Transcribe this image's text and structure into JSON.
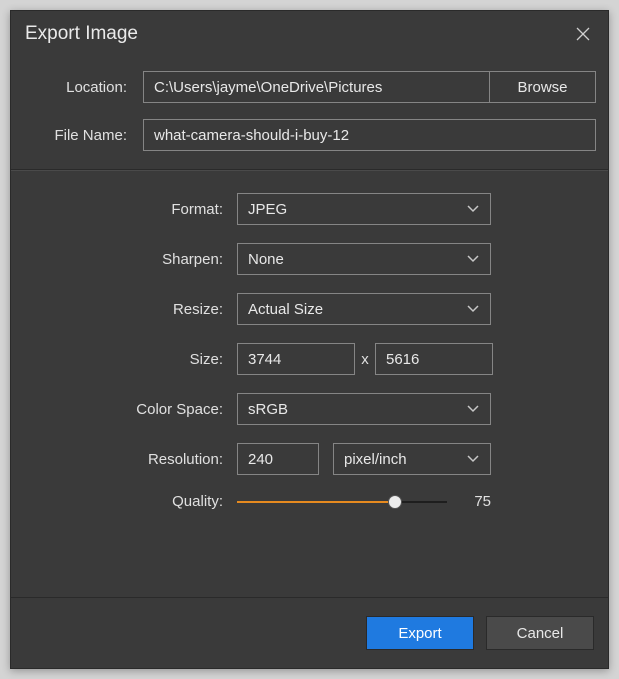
{
  "title": "Export Image",
  "location": {
    "label": "Location:",
    "value": "C:\\Users\\jayme\\OneDrive\\Pictures",
    "browse": "Browse"
  },
  "filename": {
    "label": "File Name:",
    "value": "what-camera-should-i-buy-12"
  },
  "format": {
    "label": "Format:",
    "value": "JPEG"
  },
  "sharpen": {
    "label": "Sharpen:",
    "value": "None"
  },
  "resize": {
    "label": "Resize:",
    "value": "Actual Size"
  },
  "size": {
    "label": "Size:",
    "w": "3744",
    "sep": "x",
    "h": "5616"
  },
  "colorspace": {
    "label": "Color Space:",
    "value": "sRGB"
  },
  "resolution": {
    "label": "Resolution:",
    "value": "240",
    "unit": "pixel/inch"
  },
  "quality": {
    "label": "Quality:",
    "value": "75"
  },
  "buttons": {
    "export": "Export",
    "cancel": "Cancel"
  }
}
